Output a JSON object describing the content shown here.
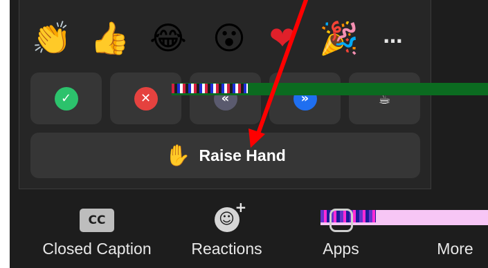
{
  "reactions_panel": {
    "emojis": [
      {
        "glyph": "👏",
        "icon": "clapping-hands-icon"
      },
      {
        "glyph": "👍",
        "icon": "thumbs-up-icon"
      },
      {
        "glyph": "😂",
        "icon": "tears-of-joy-icon"
      },
      {
        "glyph": "😮",
        "icon": "surprised-face-icon"
      },
      {
        "glyph": "❤",
        "icon": "heart-icon"
      },
      {
        "glyph": "🎉",
        "icon": "party-popper-icon"
      }
    ],
    "more_label": "…",
    "nonverbal": [
      {
        "glyph": "✓",
        "icon": "yes-check-icon",
        "color": "#2cc26c"
      },
      {
        "glyph": "✕",
        "icon": "no-x-icon",
        "color": "#e5423f"
      },
      {
        "glyph": "«",
        "icon": "slow-down-icon",
        "color": "#5a5a6e"
      },
      {
        "glyph": "»",
        "icon": "speed-up-icon",
        "color": "#1f6ff0"
      },
      {
        "glyph": "☕",
        "icon": "coffee-icon",
        "color": "#ffffff"
      }
    ],
    "raise_hand": {
      "glyph": "✋",
      "label": "Raise Hand"
    }
  },
  "toolbar": {
    "items": [
      {
        "label": "Closed Caption",
        "icon_text": "CC"
      },
      {
        "label": "Reactions",
        "icon_text": "☺",
        "plus": "+"
      },
      {
        "label": "Apps"
      },
      {
        "label": "More"
      }
    ]
  },
  "annotation": {
    "arrow_color": "#ff0000"
  }
}
